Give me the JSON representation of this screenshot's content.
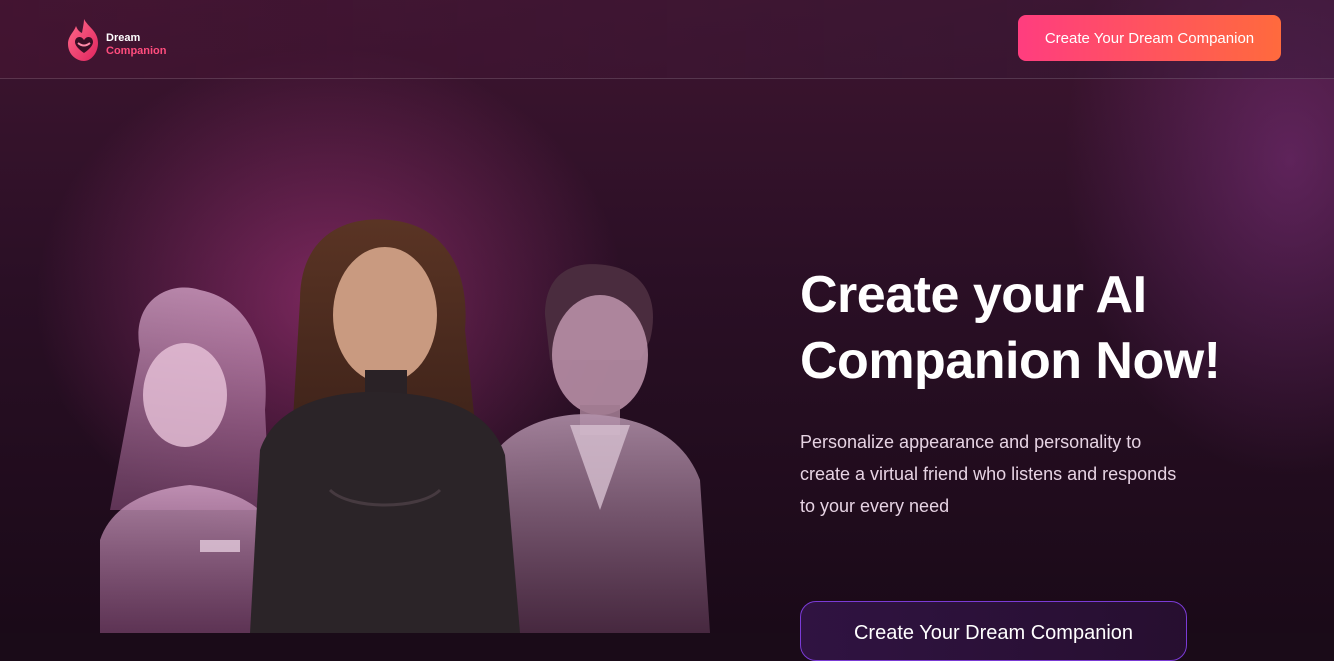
{
  "header": {
    "logo": {
      "line1": "Dream",
      "line2": "Companion"
    },
    "cta_label": "Create Your Dream Companion"
  },
  "hero": {
    "title_line1": "Create your AI",
    "title_line2": "Companion Now!",
    "subtitle": "Personalize appearance and personality to create a virtual friend who listens and responds to your every need",
    "cta_label": "Create Your Dream Companion"
  },
  "colors": {
    "accent_start": "#ff3d7f",
    "accent_end": "#ff6a3d",
    "outline_button": "#7b3bd6"
  }
}
